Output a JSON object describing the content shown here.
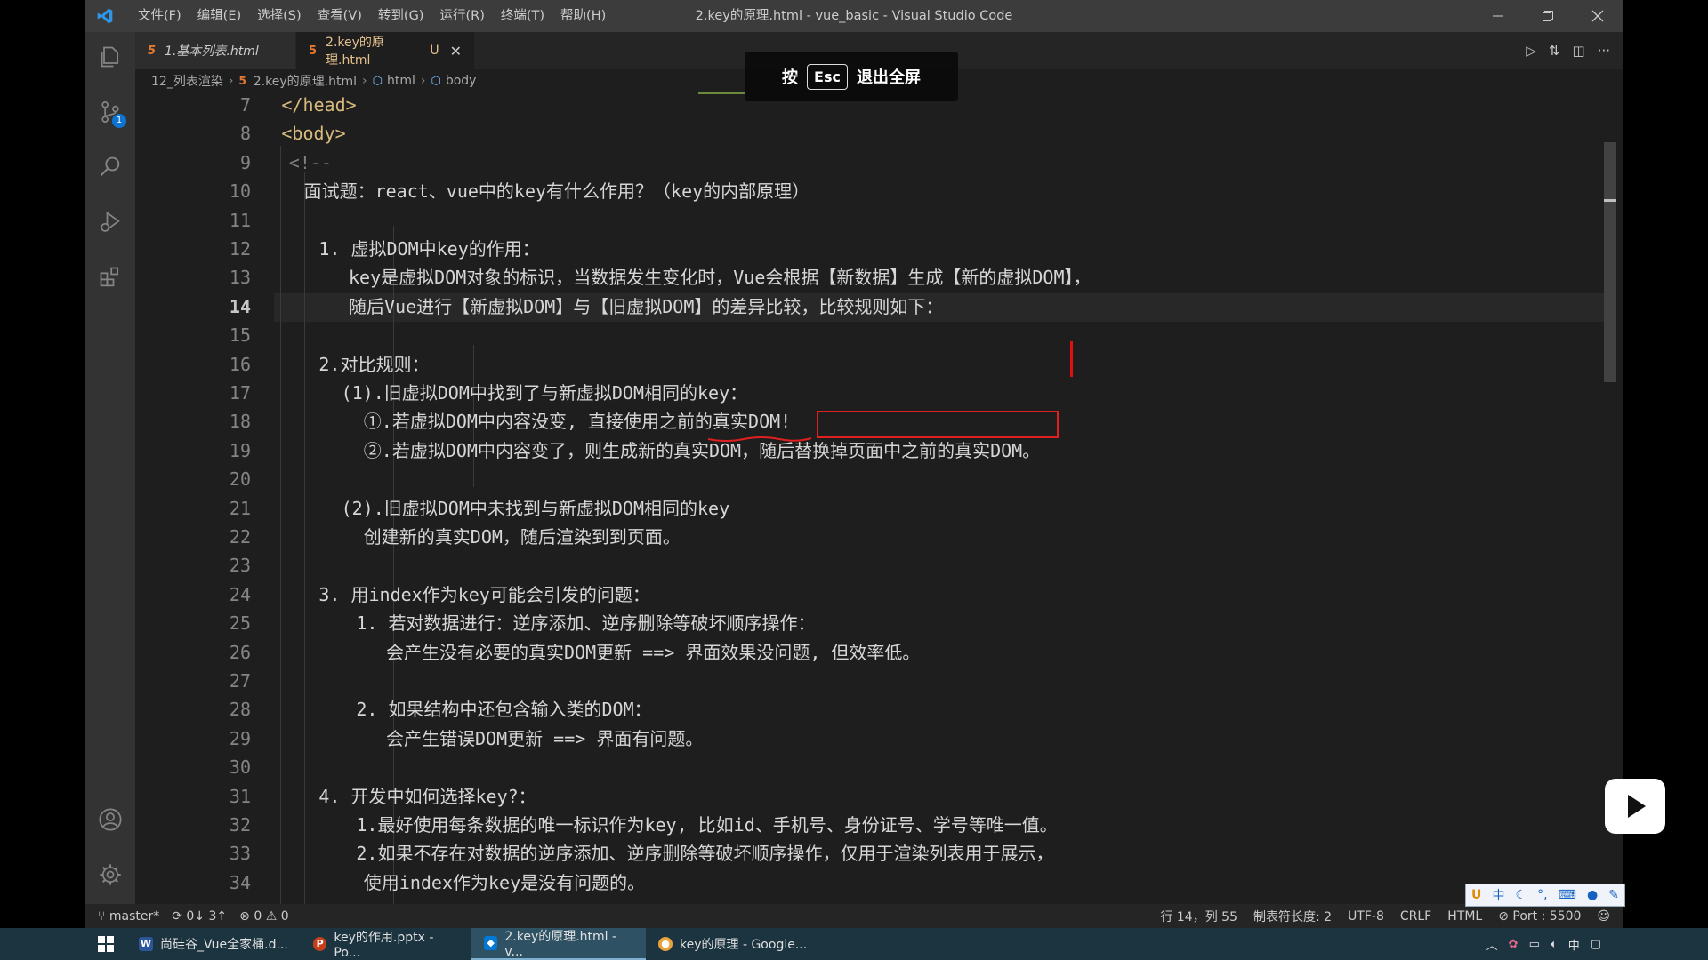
{
  "titlebar": {
    "menu": [
      "文件(F)",
      "编辑(E)",
      "选择(S)",
      "查看(V)",
      "转到(G)",
      "运行(R)",
      "终端(T)",
      "帮助(H)"
    ],
    "title": "2.key的原理.html - vue_basic - Visual Studio Code"
  },
  "activity": {
    "icons": [
      "explorer-icon",
      "source-control-icon",
      "search-icon",
      "run-debug-icon",
      "extensions-icon",
      "account-icon",
      "settings-gear-icon"
    ],
    "scm_badge": "1"
  },
  "tabs": [
    {
      "label": "1.基本列表.html",
      "icon": "html5-icon"
    },
    {
      "label": "2.key的原理.html",
      "icon": "html5-icon",
      "modified": "U",
      "active": true
    }
  ],
  "breadcrumb": [
    "12_列表渲染",
    "2.key的原理.html",
    "html",
    "body"
  ],
  "overlay": {
    "pre": "按",
    "key": "Esc",
    "post": "退出全屏"
  },
  "code": {
    "lines": [
      {
        "n": "7",
        "text": "</head>"
      },
      {
        "n": "8",
        "text": "<body>"
      },
      {
        "n": "9",
        "text": "<!--"
      },
      {
        "n": "10",
        "text": "面试题：react、vue中的key有什么作用？（key的内部原理）"
      },
      {
        "n": "11",
        "text": ""
      },
      {
        "n": "12",
        "text": "1. 虚拟DOM中key的作用："
      },
      {
        "n": "13",
        "text": "key是虚拟DOM对象的标识，当数据发生变化时，Vue会根据【新数据】生成【新的虚拟DOM】，"
      },
      {
        "n": "14",
        "text": "随后Vue进行【新虚拟DOM】与【旧虚拟DOM】的差异比较，比较规则如下："
      },
      {
        "n": "15",
        "text": ""
      },
      {
        "n": "16",
        "text": "2.对比规则："
      },
      {
        "n": "17",
        "text": "(1).旧虚拟DOM中找到了与新虚拟DOM相同的key："
      },
      {
        "n": "18",
        "text": "①.若虚拟DOM中内容没变, 直接使用之前的真实DOM!"
      },
      {
        "n": "19",
        "text": "②.若虚拟DOM中内容变了，则生成新的真实DOM，随后替换掉页面中之前的真实DOM。"
      },
      {
        "n": "20",
        "text": ""
      },
      {
        "n": "21",
        "text": "(2).旧虚拟DOM中未找到与新虚拟DOM相同的key"
      },
      {
        "n": "22",
        "text": "创建新的真实DOM，随后渲染到到页面。"
      },
      {
        "n": "23",
        "text": ""
      },
      {
        "n": "24",
        "text": "3. 用index作为key可能会引发的问题："
      },
      {
        "n": "25",
        "text": "1. 若对数据进行：逆序添加、逆序删除等破坏顺序操作："
      },
      {
        "n": "26",
        "text": "会产生没有必要的真实DOM更新 ==> 界面效果没问题, 但效率低。"
      },
      {
        "n": "27",
        "text": ""
      },
      {
        "n": "28",
        "text": "2. 如果结构中还包含输入类的DOM："
      },
      {
        "n": "29",
        "text": "会产生错误DOM更新 ==> 界面有问题。"
      },
      {
        "n": "30",
        "text": ""
      },
      {
        "n": "31",
        "text": "4. 开发中如何选择key?："
      },
      {
        "n": "32",
        "text": "1.最好使用每条数据的唯一标识作为key, 比如id、手机号、身份证号、学号等唯一值。"
      },
      {
        "n": "33",
        "text": "2.如果不存在对数据的逆序添加、逆序删除等破坏顺序操作，仅用于渲染列表用于展示，"
      },
      {
        "n": "34",
        "text": "使用index作为key是没有问题的。"
      }
    ],
    "active_line": "14"
  },
  "status": {
    "branch": "master*",
    "sync": "0↓ 3↑",
    "errors": "0",
    "warnings": "0",
    "position": "行 14，列 55",
    "tab_size": "制表符长度: 2",
    "encoding": "UTF-8",
    "eol": "CRLF",
    "language": "HTML",
    "port": "Port : 5500"
  },
  "ime": [
    "中",
    "°,"
  ],
  "taskbar": {
    "items": [
      {
        "label": "尚硅谷_Vue全家桶.d...",
        "icon": "W",
        "color": "#2b579a"
      },
      {
        "label": "key的作用.pptx - Po...",
        "icon": "P",
        "color": "#c43e1c"
      },
      {
        "label": "2.key的原理.html - v...",
        "icon": "vscode-icon",
        "color": "#0078d4",
        "active": true
      },
      {
        "label": "key的原理 - Google...",
        "icon": "chrome-icon",
        "color": "#e8a33d"
      }
    ],
    "tray_ime": "中"
  }
}
